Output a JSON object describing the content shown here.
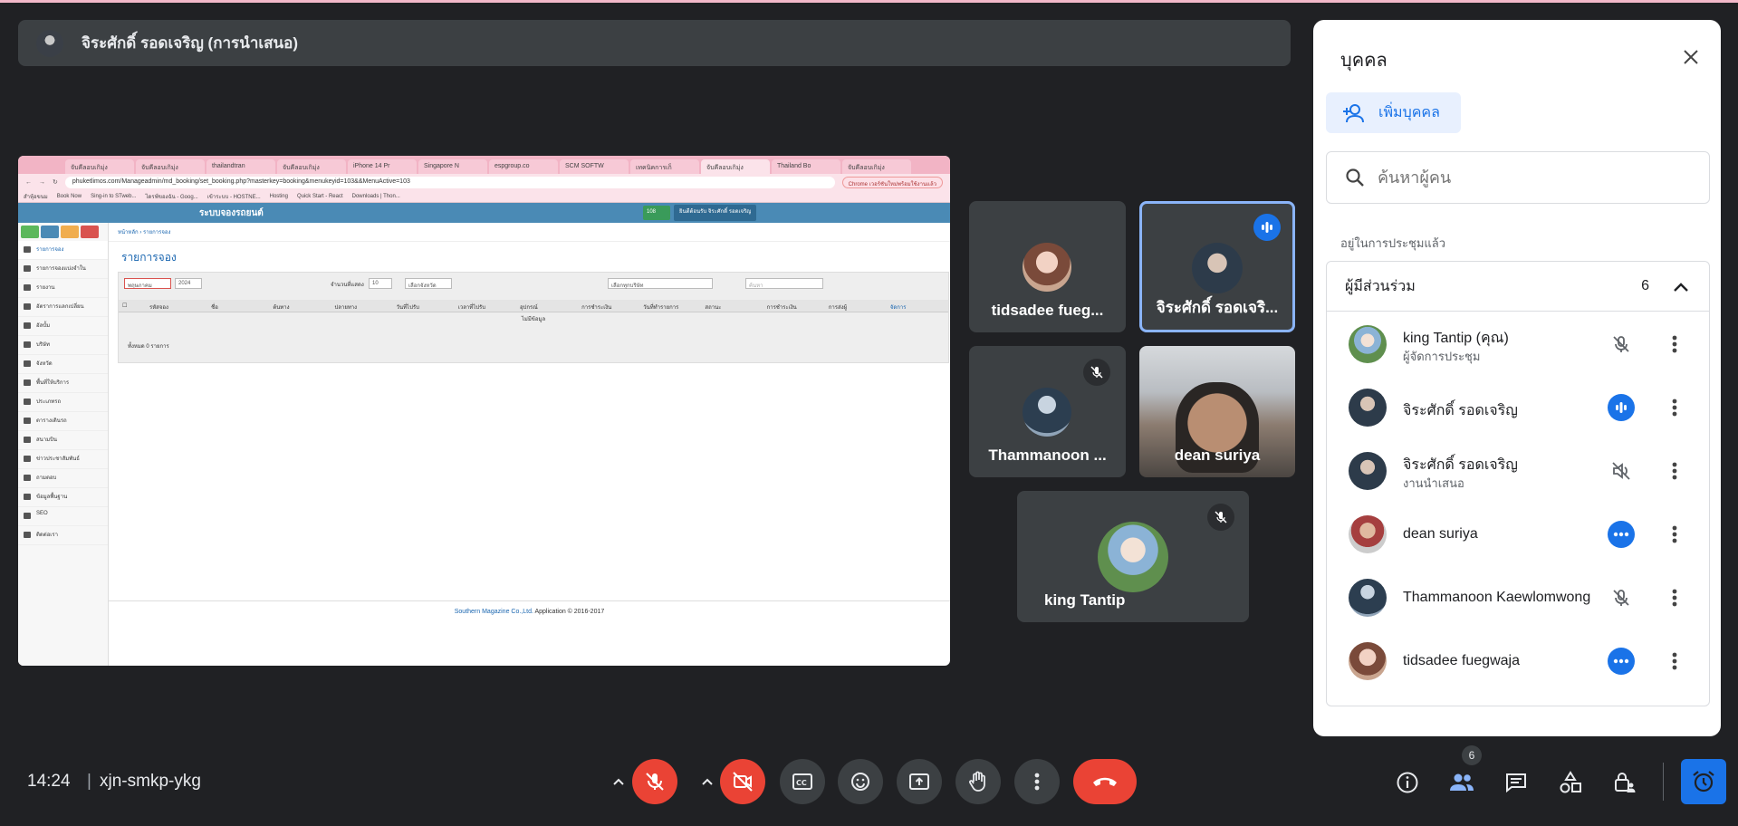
{
  "presenter": {
    "label": "จิระศักดิ์ รอดเจริญ (การนำเสนอ)"
  },
  "shared_screen": {
    "tabs": [
      "จับคีลอบเกิมุ่ง",
      "จับคีลอบเกิมุ่ง",
      "thailandtran",
      "จับคีลอบเกิมุ่ง",
      "iPhone 14 Pr",
      "Singapore N",
      "espgroup.co",
      "SCM SOFTW",
      "เทคนิคการเก็",
      "จับคีลอบเกิมุ่ง",
      "Thailand Bo",
      "จับคีลอบเกิมุ่ง"
    ],
    "url": "phuketlimos.com/Manageadmin/md_booking/set_booking.php?masterkey=booking&menukeyid=103&&MenuActive=103",
    "chrome_notice": "Chrome เวอร์ชันใหม่พร้อมใช้งานแล้ว",
    "bookmarks": [
      "สำหุ้อขนม",
      "Book Now",
      "Sing-in to STweb...",
      "ไดรฟ์ของฉัน - Goog...",
      "เข้าระบบ - HOSTNE...",
      "Hosting",
      "Quick Start - React",
      "Downloads | Thon..."
    ],
    "brand": "ระบบจองรถยนต์",
    "mail_count": "108",
    "user": "ยินดีต้อนรับ จิระศักดิ์ รอดเจริญ",
    "sidebar": [
      "รายการจอง",
      "รายการจองแบ่งจำใน",
      "รายงาน",
      "อัตราการแลกเปลี่ยน",
      "อัลบั้ม",
      "บริษัท",
      "จังหวัด",
      "พื้นที่ให้บริการ",
      "ประเภทรถ",
      "ตารางเดินรถ",
      "สนามบิน",
      "ข่าวประชาสัมพันธ์",
      "ถามตอบ",
      "ข้อมูลพื้นฐาน",
      "SEO",
      "ติดต่อเรา"
    ],
    "crumbs": "หน้าหลัก › รายการจอง",
    "page_title": "รายการจอง",
    "filter": {
      "month": "พฤษภาคม",
      "year": "2024",
      "show_label": "จำนวนที่แสดง",
      "show_value": "10",
      "province": "เลือกจังหวัด",
      "company": "เลือกทุกบริษัท",
      "search_placeholder": "ค้นหา"
    },
    "columns": [
      "รหัสจอง",
      "ชื่อ",
      "ต้นทาง",
      "ปลายทาง",
      "วันที่ไปรับ",
      "เวลาที่ไปรับ",
      "อุปกรณ์",
      "การชำระเงิน",
      "วันที่ทำรายการ",
      "สถานะ",
      "การชำระเงิน",
      "การส่งผู้",
      "จัดการ"
    ],
    "no_data": "ไม่มีข้อมูล",
    "total": "ทั้งหมด 0 รายการ",
    "footer_link": "Southern Magazine Co.,Ltd.",
    "footer_text": " Application © 2016-2017"
  },
  "tiles": [
    {
      "name": "tidsadee fueg...",
      "state": "none"
    },
    {
      "name": "จิระศักดิ์ รอดเจริ...",
      "state": "speaking"
    },
    {
      "name": "Thammanoon ...",
      "state": "muted"
    },
    {
      "name": "dean suriya",
      "state": "video"
    },
    {
      "name": "king Tantip",
      "state": "muted"
    }
  ],
  "panel": {
    "title": "บุคคล",
    "add_label": "เพิ่มบุคคล",
    "search_placeholder": "ค้นหาผู้คน",
    "section": "อยู่ในการประชุมแล้ว",
    "group_label": "ผู้มีส่วนร่วม",
    "group_count": "6",
    "people": [
      {
        "name": "king Tantip (คุณ)",
        "sub": "ผู้จัดการประชุม",
        "status": "muted"
      },
      {
        "name": "จิระศักดิ์ รอดเจริญ",
        "sub": "",
        "status": "speaking"
      },
      {
        "name": "จิระศักดิ์ รอดเจริญ",
        "sub": "งานนำเสนอ",
        "status": "audio-off"
      },
      {
        "name": "dean suriya",
        "sub": "",
        "status": "more"
      },
      {
        "name": "Thammanoon Kaewlomwong",
        "sub": "",
        "status": "muted"
      },
      {
        "name": "tidsadee fuegwaja",
        "sub": "",
        "status": "more"
      }
    ]
  },
  "bottom": {
    "time": "14:24",
    "separator": "|",
    "meeting_code": "xjn-smkp-ykg",
    "people_badge": "6"
  },
  "colors": {
    "background": "#202124",
    "surface": "#3c4043",
    "accent": "#1a73e8",
    "danger": "#ea4335"
  }
}
